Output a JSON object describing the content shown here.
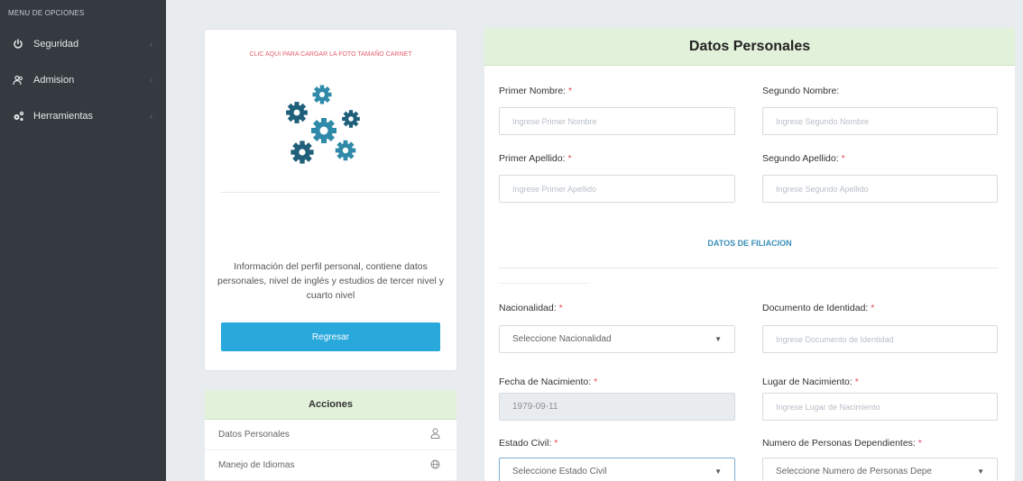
{
  "sidebar": {
    "header": "MENU DE OPCIONES",
    "items": [
      {
        "label": "Seguridad",
        "icon": "power-icon"
      },
      {
        "label": "Admision",
        "icon": "users-icon"
      },
      {
        "label": "Herramientas",
        "icon": "cogs-icon"
      }
    ]
  },
  "photo_card": {
    "upload_link": "CLIC AQUI PARA CARGAR LA FOTO TAMAÑO CARNET",
    "description": "Información del perfil personal, contiene datos personales, nivel de inglés y estudios de tercer nivel y cuarto nivel",
    "back_button": "Regresar",
    "gear_color": "#1f5f7a"
  },
  "actions": {
    "title": "Acciones",
    "items": [
      {
        "label": "Datos Personales",
        "icon": "user-icon"
      },
      {
        "label": "Manejo de Idiomas",
        "icon": "globe-icon"
      }
    ]
  },
  "form": {
    "title": "Datos Personales",
    "primer_nombre": {
      "label": "Primer Nombre:",
      "placeholder": "Ingrese Primer Nombre"
    },
    "segundo_nombre": {
      "label": "Segundo Nombre:",
      "placeholder": "Ingrese Segundo Nombre"
    },
    "primer_apellido": {
      "label": "Primer Apellido:",
      "placeholder": "Ingrese Primer Apellido"
    },
    "segundo_apellido": {
      "label": "Segundo Apellido:",
      "placeholder": "Ingrese Segundo Apellido"
    },
    "filiacion_title": "DATOS DE FILIACION",
    "nacionalidad": {
      "label": "Nacionalidad:",
      "value": "Seleccione Nacionalidad"
    },
    "documento": {
      "label": "Documento de Identidad:",
      "placeholder": "Ingrese Documento de Identidad"
    },
    "fecha_nacimiento": {
      "label": "Fecha de Nacimiento:",
      "value": "1979-09-11"
    },
    "lugar_nacimiento": {
      "label": "Lugar de Nacimiento:",
      "placeholder": "Ingrese Lugar de Nacimiento"
    },
    "estado_civil": {
      "label": "Estado Civil:",
      "value": "Seleccione Estado Civil"
    },
    "dependientes": {
      "label": "Numero de Personas Dependientes:",
      "value": "Seleccione Numero de Personas Depe"
    },
    "required_mark": "*"
  },
  "colors": {
    "sidebar_bg": "#343a40",
    "header_green": "#e2f1da",
    "button_blue": "#29a8dc",
    "required_red": "#e04a5c"
  }
}
